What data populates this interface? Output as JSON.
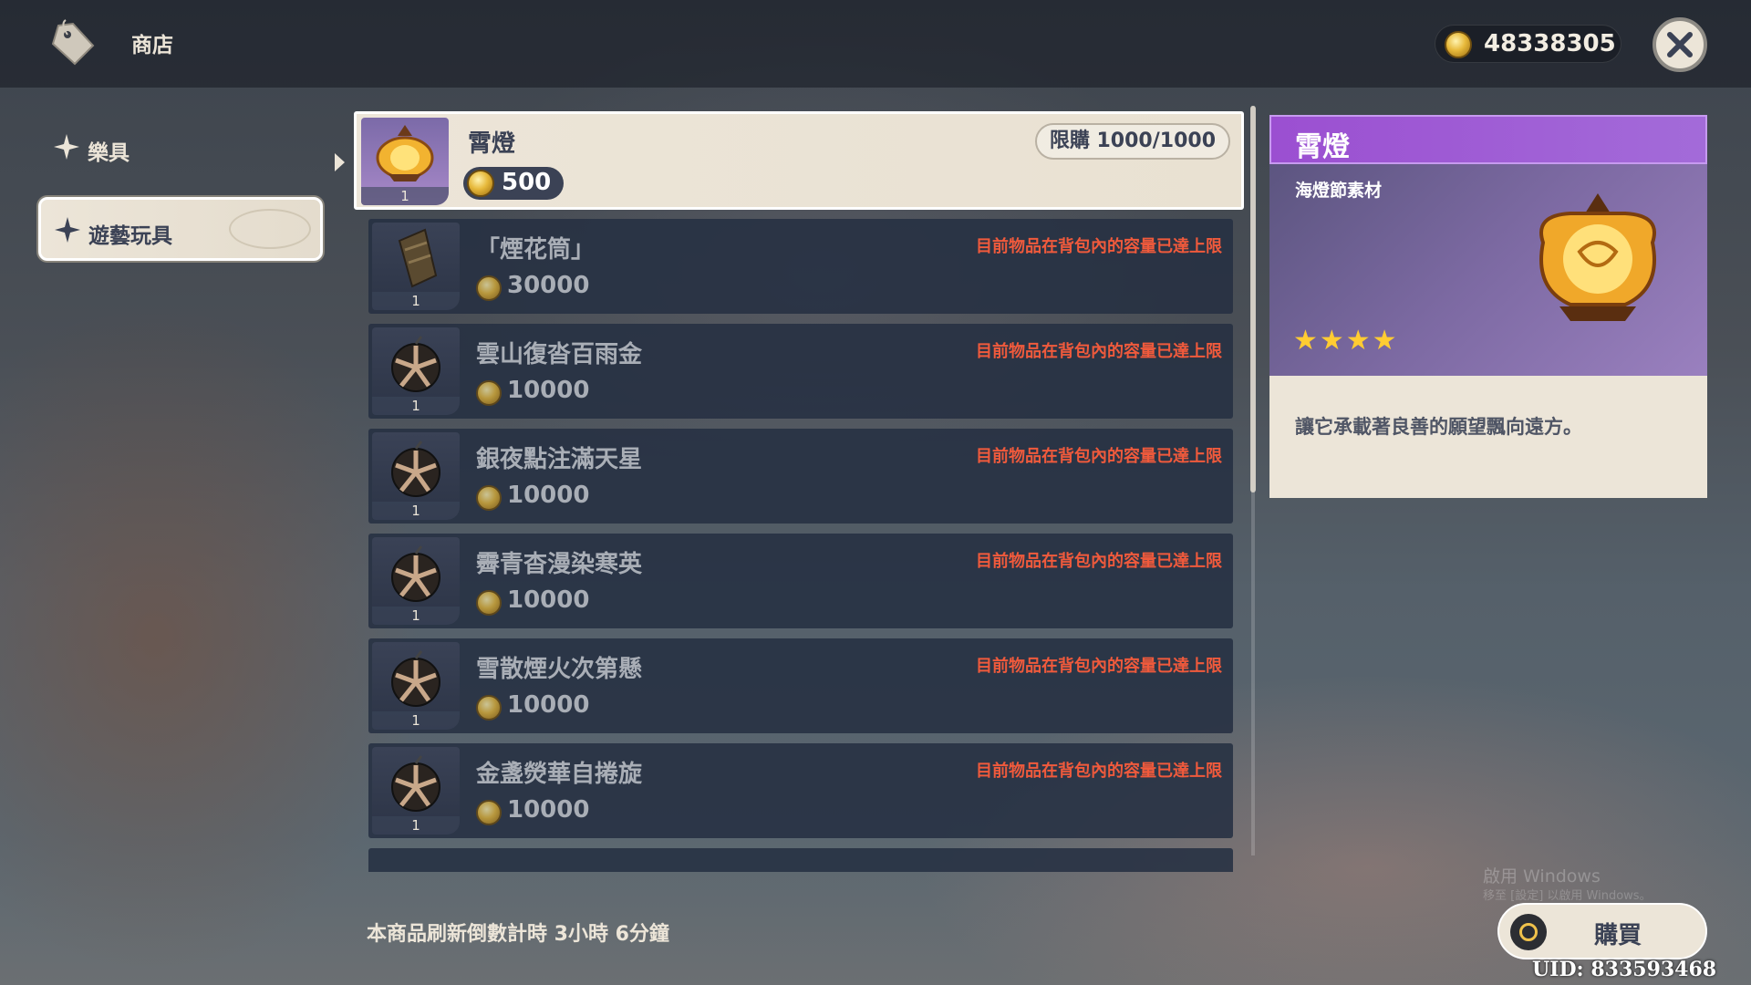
{
  "header": {
    "title": "商店",
    "currency_amount": "48338305"
  },
  "sidebar": {
    "items": [
      {
        "label": "樂具",
        "selected": false
      },
      {
        "label": "遊藝玩具",
        "selected": true
      }
    ]
  },
  "selected_item": {
    "name": "霄燈",
    "price": "500",
    "limit": "限購 1000/1000",
    "quantity": "1"
  },
  "items": [
    {
      "name": "「煙花筒」",
      "price": "30000",
      "quantity": "1",
      "notice": "目前物品在背包內的容量已達上限",
      "icon": "firework-tube-icon"
    },
    {
      "name": "雲山復沓百雨金",
      "price": "10000",
      "quantity": "1",
      "notice": "目前物品在背包內的容量已達上限",
      "icon": "firework-ball-icon"
    },
    {
      "name": "銀夜點注滿天星",
      "price": "10000",
      "quantity": "1",
      "notice": "目前物品在背包內的容量已達上限",
      "icon": "firework-ball-icon"
    },
    {
      "name": "霽青杳漫染寒英",
      "price": "10000",
      "quantity": "1",
      "notice": "目前物品在背包內的容量已達上限",
      "icon": "firework-ball-icon"
    },
    {
      "name": "雪散煙火次第懸",
      "price": "10000",
      "quantity": "1",
      "notice": "目前物品在背包內的容量已達上限",
      "icon": "firework-ball-icon"
    },
    {
      "name": "金盞熒華自捲旋",
      "price": "10000",
      "quantity": "1",
      "notice": "目前物品在背包內的容量已達上限",
      "icon": "firework-ball-icon"
    }
  ],
  "refresh_text": "本商品刷新倒數計時 3小時 6分鐘",
  "detail": {
    "title": "霄燈",
    "type": "海燈節素材",
    "stars": "★★★★",
    "rarity": 4,
    "description": "讓它承載著良善的願望飄向遠方。"
  },
  "buy_label": "購買",
  "watermark": "啟用 Windows",
  "watermark_sub": "移至 [設定] 以啟用 Windows。",
  "uid": "UID: 833593468",
  "colors": {
    "accent_purple": "#9b4fd1",
    "notice_red": "#f05a3c",
    "panel_cream": "#ece5d8",
    "star_gold": "#ffcc32"
  }
}
